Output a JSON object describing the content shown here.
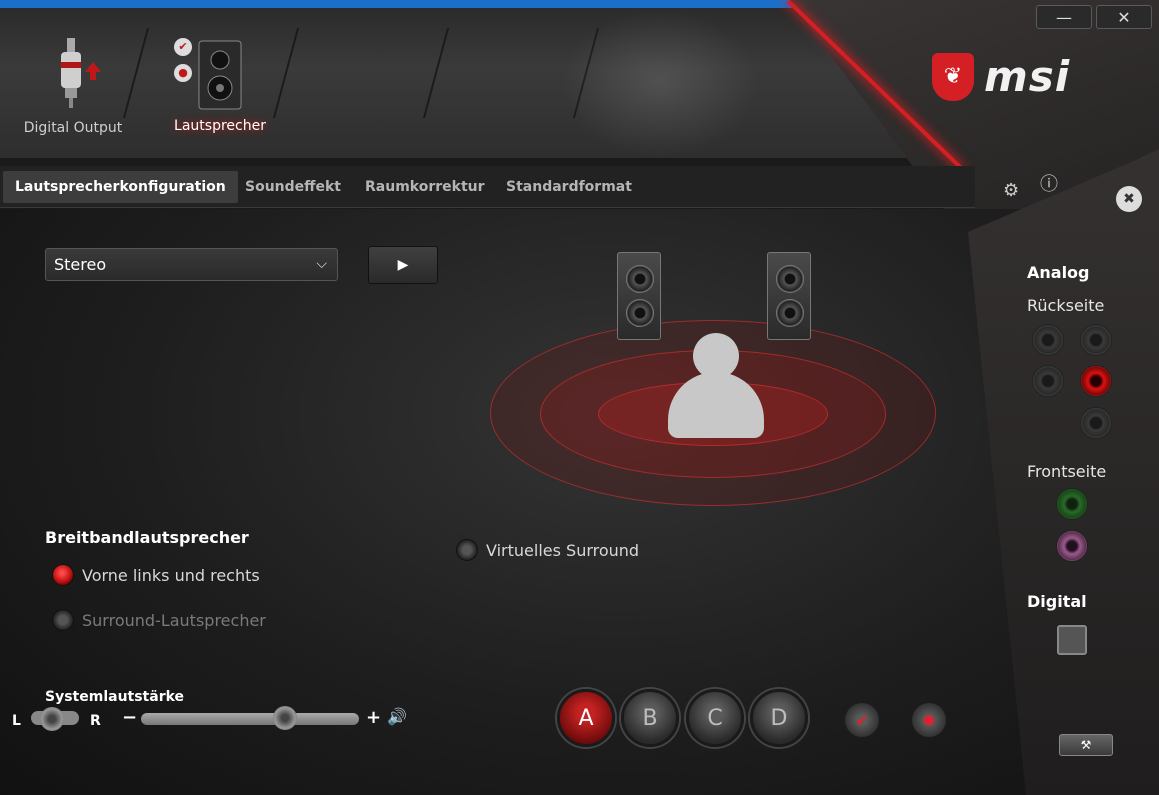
{
  "window": {
    "minimize_label": "—",
    "close_label": "✕"
  },
  "brand": {
    "logo_text": "msi",
    "shield_glyph": "❦"
  },
  "devices": [
    {
      "label": "Digital Output",
      "icon": "digital-output-plug-icon"
    },
    {
      "label": "Lautsprecher",
      "icon": "speaker-icon"
    }
  ],
  "tabs": [
    {
      "label": "Lautsprecherkonfiguration"
    },
    {
      "label": "Soundeffekt"
    },
    {
      "label": "Raumkorrektur"
    },
    {
      "label": "Standardformat"
    }
  ],
  "config": {
    "selected": "Stereo",
    "chevron": "⌵",
    "play_glyph": "▶"
  },
  "fullrange": {
    "title": "Breitbandlautsprecher",
    "options": [
      {
        "label": "Vorne links und rechts",
        "checked": true
      },
      {
        "label": "Surround-Lautsprecher",
        "checked": false
      }
    ]
  },
  "virtual_surround": {
    "label": "Virtuelles Surround",
    "checked": false
  },
  "volume": {
    "title": "Systemlautstärke",
    "left": "L",
    "right": "R",
    "minus": "−",
    "plus": "+",
    "speaker_glyph": "🔊",
    "level_fraction": 0.66
  },
  "profiles": [
    {
      "label": "A",
      "active": true
    },
    {
      "label": "B",
      "active": false
    },
    {
      "label": "C",
      "active": false
    },
    {
      "label": "D",
      "active": false
    }
  ],
  "profile_actions": {
    "check_glyph": "✔",
    "mic_glyph": "⬤"
  },
  "top_icons": {
    "gear": "⚙",
    "info": "ⓘ",
    "close_x": "✖"
  },
  "jacks_panel": {
    "analog_title": "Analog",
    "rear_label": "Rückseite",
    "front_label": "Frontseite",
    "digital_title": "Digital",
    "tool_glyph": "⚒",
    "colors": {
      "active_rear": "#e01010",
      "front_green": "#2a6a2a",
      "front_pink": "#9a5a8a"
    }
  }
}
